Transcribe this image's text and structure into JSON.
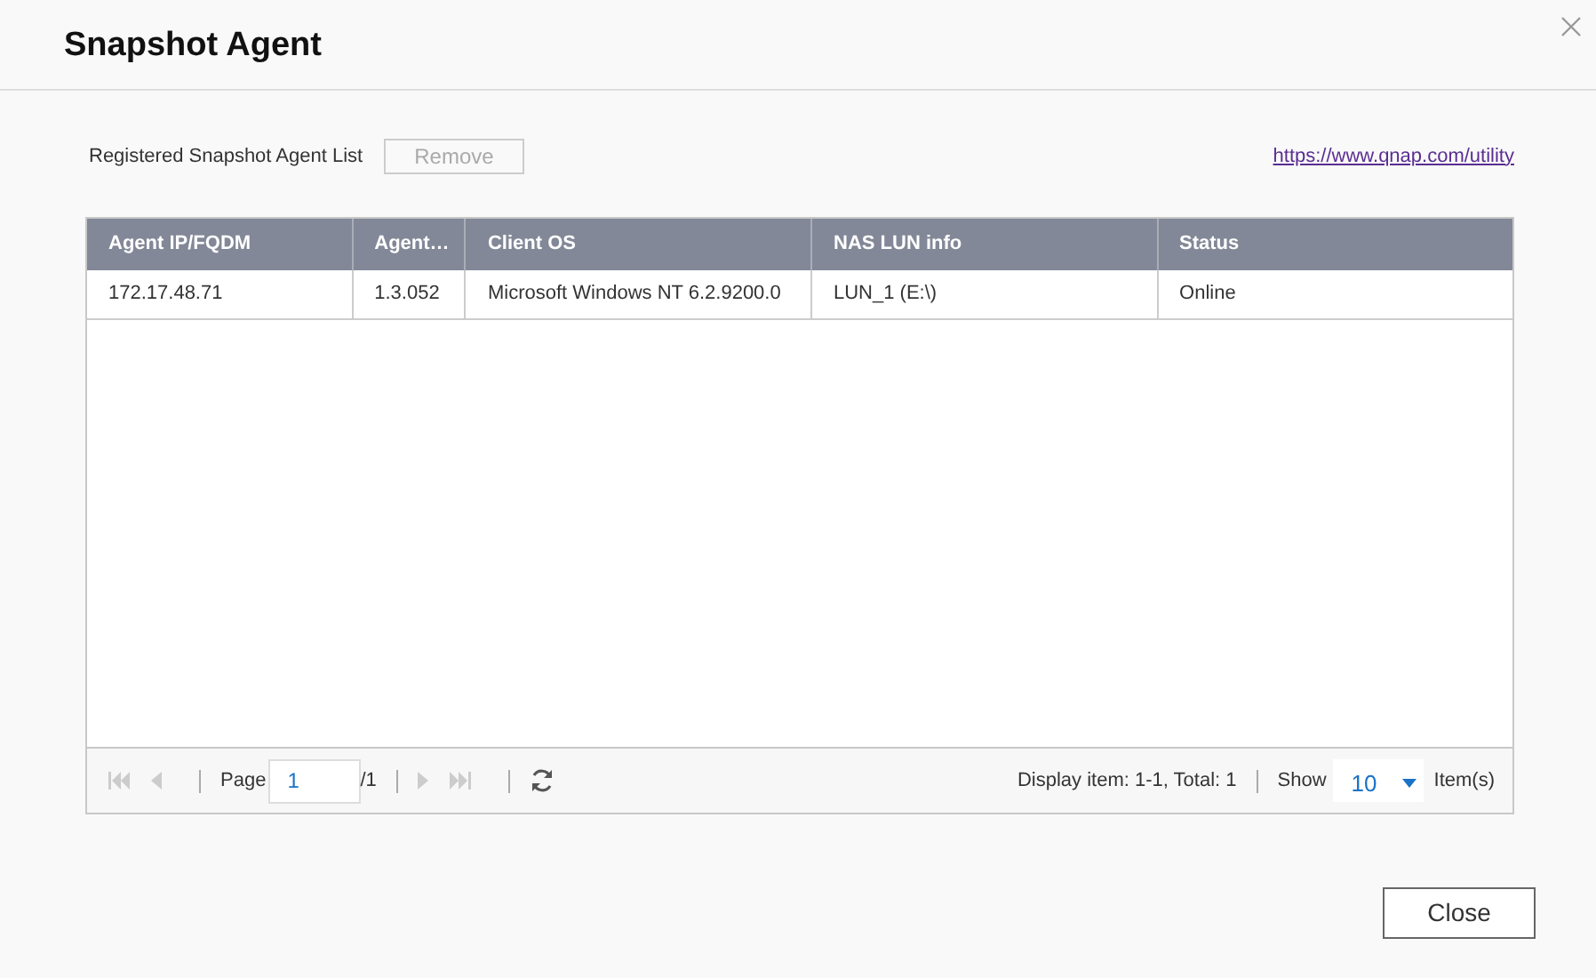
{
  "window": {
    "title": "Snapshot Agent"
  },
  "toolbar": {
    "label": "Registered Snapshot Agent List",
    "remove_button": {
      "label": "Remove",
      "disabled": true
    },
    "link": "https://www.qnap.com/utility"
  },
  "table": {
    "columns": [
      "Agent IP/FQDM",
      "Agent…",
      "Client OS",
      "NAS LUN info",
      "Status"
    ],
    "rows": [
      [
        "172.17.48.71",
        "1.3.052",
        "Microsoft Windows NT 6.2.9200.0",
        "LUN_1 (E:\\)",
        "Online"
      ]
    ]
  },
  "pager": {
    "page_label": "Page",
    "page": "1",
    "page_total": "/1",
    "display": "Display item: 1-1, Total: 1",
    "show_label": "Show",
    "show_value": "10",
    "items_label": "Item(s)"
  },
  "buttons": [
    "Close"
  ]
}
